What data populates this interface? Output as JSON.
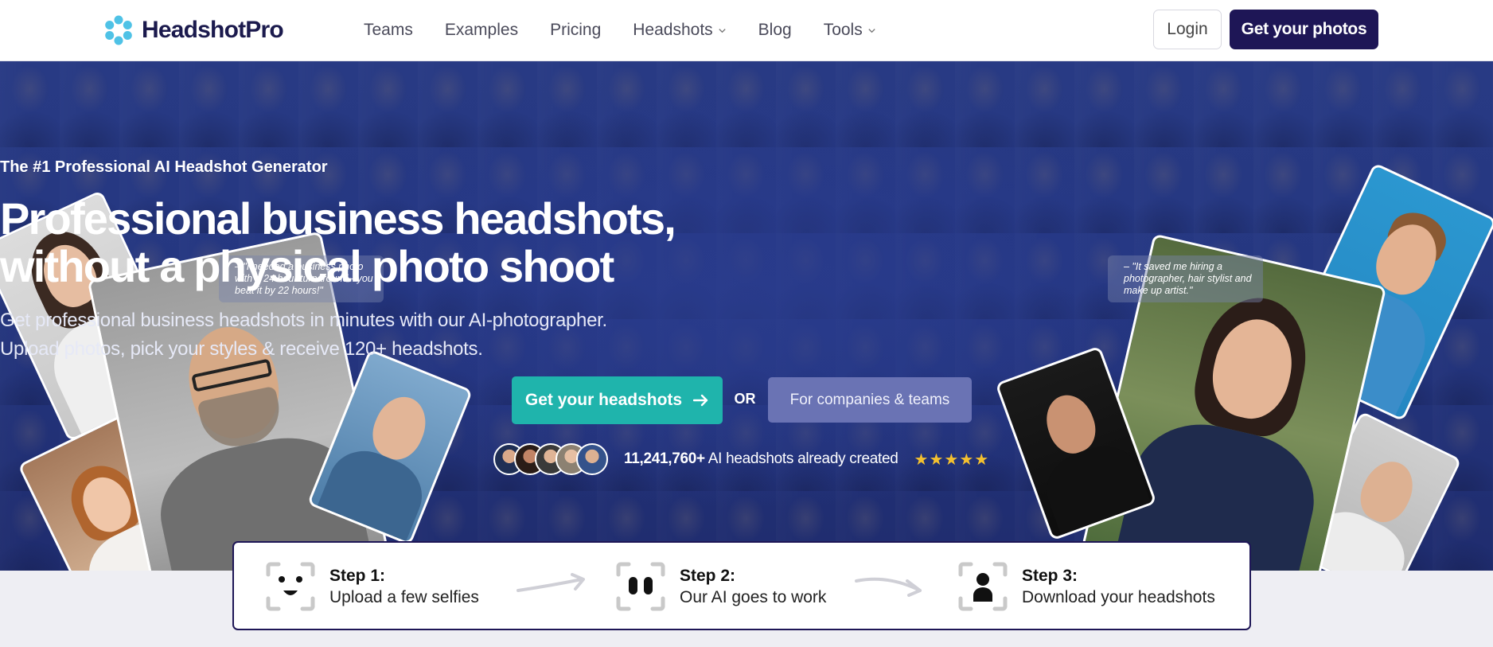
{
  "nav": {
    "brand": "HeadshotPro",
    "links": [
      {
        "label": "Teams",
        "has_dropdown": false
      },
      {
        "label": "Examples",
        "has_dropdown": false
      },
      {
        "label": "Pricing",
        "has_dropdown": false
      },
      {
        "label": "Headshots",
        "has_dropdown": true
      },
      {
        "label": "Blog",
        "has_dropdown": false
      },
      {
        "label": "Tools",
        "has_dropdown": true
      }
    ],
    "login_label": "Login",
    "cta_label": "Get your photos"
  },
  "hero": {
    "kicker": "The #1 Professional AI Headshot Generator",
    "headline_line1": "Professional business headshots,",
    "headline_line2": "without a physical photo shoot",
    "sub_line1": "Get professional business headshots in minutes with our AI-photographer.",
    "sub_line2": "Upload photos, pick your styles & receive 120+ headshots.",
    "primary_button": "Get your headshots",
    "or_label": "OR",
    "secondary_button": "For companies & teams",
    "count": "11,241,760+",
    "count_suffix": " AI headshots already created",
    "stars": "★★★★★",
    "rating": 5,
    "quote_left": "– \"I needed a business photo with a 24 hour turnaround - you beat it by 22 hours!\"",
    "quote_right": "– \"It saved me hiring a photographer, hair stylist and make up artist.\""
  },
  "steps": [
    {
      "title": "Step 1:",
      "desc": "Upload a few selfies",
      "icon": "smiley-face-icon"
    },
    {
      "title": "Step 2:",
      "desc": "Our AI goes to work",
      "icon": "ai-eyes-icon"
    },
    {
      "title": "Step 3:",
      "desc": "Download your headshots",
      "icon": "person-portrait-icon"
    }
  ],
  "colors": {
    "brand_navy": "#1e1656",
    "hero_blue": "#253781",
    "teal": "#1fb4ac",
    "secondary_button": "#6a73b4",
    "star": "#f3c02f"
  }
}
